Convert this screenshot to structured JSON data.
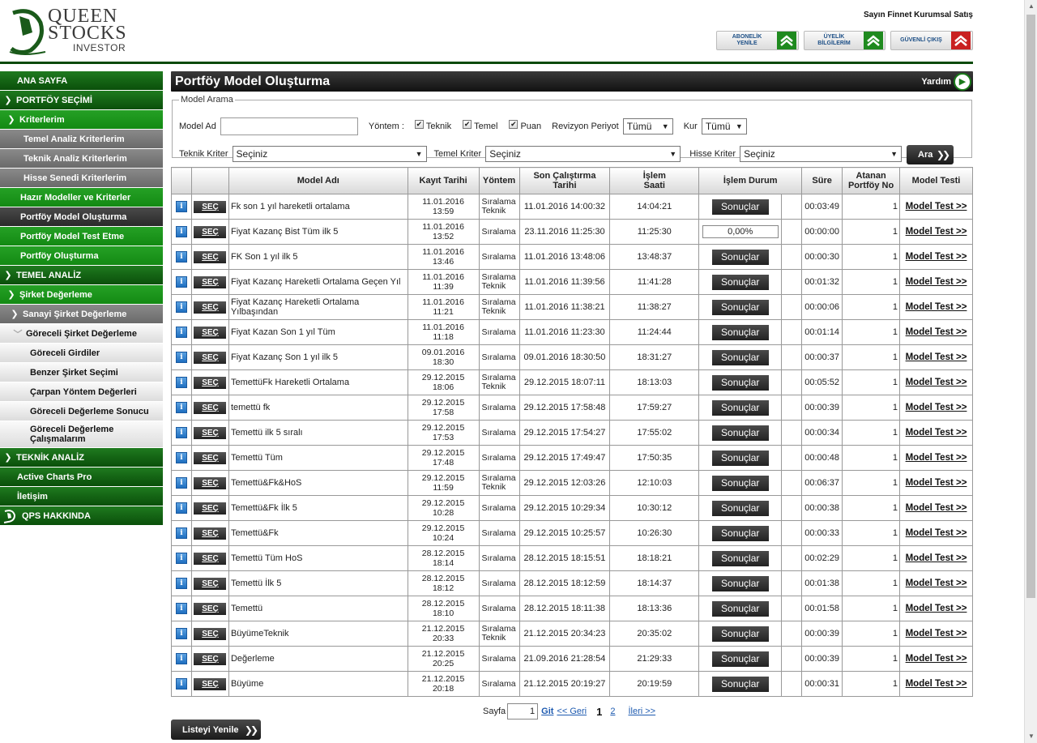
{
  "brand": {
    "line1": "QUEEN",
    "line2": "STOCKS",
    "line3": "INVESTOR"
  },
  "header": {
    "user": "Sayın Finnet Kurumsal Satış",
    "buttons": [
      {
        "label1": "ABONELİK",
        "label2": "YENİLE",
        "icon": "green-chevron-up-icon"
      },
      {
        "label1": "ÜYELİK",
        "label2": "BİLGİLERİM",
        "icon": "green-chevron-up-icon"
      },
      {
        "label1": "GÜVENLİ ÇIKIŞ",
        "label2": "",
        "icon": "red-chevron-up-icon"
      }
    ]
  },
  "sidebar": {
    "items": [
      {
        "label": "ANA SAYFA"
      },
      {
        "label": "PORTFÖY SEÇİMİ"
      },
      {
        "label": "Kriterlerim"
      },
      {
        "label": "Temel Analiz Kriterlerim"
      },
      {
        "label": "Teknik Analiz Kriterlerim"
      },
      {
        "label": "Hisse Senedi Kriterlerim"
      },
      {
        "label": "Hazır Modeller ve Kriterler"
      },
      {
        "label": "Portföy Model Oluşturma"
      },
      {
        "label": "Portföy Model Test Etme"
      },
      {
        "label": "Portföy Oluşturma"
      },
      {
        "label": "TEMEL ANALİZ"
      },
      {
        "label": "Şirket Değerleme"
      },
      {
        "label": "Sanayi Şirket Değerleme"
      },
      {
        "label": "Göreceli Şirket Değerleme"
      },
      {
        "label": "Göreceli Girdiler"
      },
      {
        "label": "Benzer Şirket Seçimi"
      },
      {
        "label": "Çarpan Yöntem Değerleri"
      },
      {
        "label": "Göreceli Değerleme Sonucu"
      },
      {
        "label": "Göreceli Değerleme Çalışmalarım"
      },
      {
        "label": "TEKNİK ANALİZ"
      },
      {
        "label": "Active Charts Pro"
      },
      {
        "label": "İletişim"
      },
      {
        "label": "QPS HAKKINDA"
      }
    ]
  },
  "page": {
    "title": "Portföy Model Oluşturma",
    "help": "Yardım"
  },
  "search": {
    "legend": "Model Arama",
    "model_ad_label": "Model Ad",
    "model_ad_value": "",
    "yontem_label": "Yöntem :",
    "teknik": "Teknik",
    "temel": "Temel",
    "puan": "Puan",
    "revizyon_label": "Revizyon Periyot",
    "revizyon_value": "Tümü",
    "kur_label": "Kur",
    "kur_value": "Tümü",
    "teknik_kriter_label": "Teknik Kriter",
    "teknik_kriter_value": "Seçiniz",
    "temel_kriter_label": "Temel Kriter",
    "temel_kriter_value": "Seçiniz",
    "hisse_kriter_label": "Hisse Kriter",
    "hisse_kriter_value": "Seçiniz",
    "search_button": "Ara"
  },
  "table": {
    "headers": {
      "model_adi": "Model Adı",
      "kayit": "Kayıt Tarihi",
      "yontem": "Yöntem",
      "son1": "Son Çalıştırma",
      "son2": "Tarihi",
      "islem1": "İşlem",
      "islem2": "Saati",
      "durum": "İşlem Durum",
      "sure": "Süre",
      "atanan1": "Atanan",
      "atanan2": "Portföy No",
      "test": "Model Testi"
    },
    "select_label": "SEÇ",
    "results_label": "Sonuçlar",
    "test_label": "Model Test >>",
    "rows": [
      {
        "name": "Fk son 1 yıl hareketli ortalama",
        "kd": "11.01.2016",
        "kt": "13:59",
        "y1": "Sıralama",
        "y2": "Teknik",
        "son": "11.01.2016 14:00:32",
        "saat": "14:04:21",
        "progress": "",
        "sure": "00:03:49",
        "no": "1"
      },
      {
        "name": "Fiyat Kazanç Bist Tüm ilk 5",
        "kd": "11.01.2016",
        "kt": "13:52",
        "y1": "Sıralama",
        "y2": "",
        "son": "23.11.2016 11:25:30",
        "saat": "11:25:30",
        "progress": "0,00%",
        "sure": "00:00:00",
        "no": "1"
      },
      {
        "name": "FK Son 1 yıl ilk 5",
        "kd": "11.01.2016",
        "kt": "13:46",
        "y1": "Sıralama",
        "y2": "",
        "son": "11.01.2016 13:48:06",
        "saat": "13:48:37",
        "progress": "",
        "sure": "00:00:30",
        "no": "1"
      },
      {
        "name": "Fiyat Kazanç Hareketli Ortalama Geçen Yıl",
        "kd": "11.01.2016",
        "kt": "11:39",
        "y1": "Sıralama",
        "y2": "Teknik",
        "son": "11.01.2016 11:39:56",
        "saat": "11:41:28",
        "progress": "",
        "sure": "00:01:32",
        "no": "1"
      },
      {
        "name": "Fiyat Kazanç Hareketli Ortalama Yılbaşından",
        "kd": "11.01.2016",
        "kt": "11:21",
        "y1": "Sıralama",
        "y2": "Teknik",
        "son": "11.01.2016 11:38:21",
        "saat": "11:38:27",
        "progress": "",
        "sure": "00:00:06",
        "no": "1"
      },
      {
        "name": "Fiyat Kazan Son 1 yıl Tüm",
        "kd": "11.01.2016",
        "kt": "11:18",
        "y1": "Sıralama",
        "y2": "",
        "son": "11.01.2016 11:23:30",
        "saat": "11:24:44",
        "progress": "",
        "sure": "00:01:14",
        "no": "1"
      },
      {
        "name": "Fiyat Kazanç Son 1 yıl ilk 5",
        "kd": "09.01.2016",
        "kt": "18:30",
        "y1": "Sıralama",
        "y2": "",
        "son": "09.01.2016 18:30:50",
        "saat": "18:31:27",
        "progress": "",
        "sure": "00:00:37",
        "no": "1"
      },
      {
        "name": "TemettüFk Hareketli Ortalama",
        "kd": "29.12.2015",
        "kt": "18:06",
        "y1": "Sıralama",
        "y2": "Teknik",
        "son": "29.12.2015 18:07:11",
        "saat": "18:13:03",
        "progress": "",
        "sure": "00:05:52",
        "no": "1"
      },
      {
        "name": "temettü fk",
        "kd": "29.12.2015",
        "kt": "17:58",
        "y1": "Sıralama",
        "y2": "",
        "son": "29.12.2015 17:58:48",
        "saat": "17:59:27",
        "progress": "",
        "sure": "00:00:39",
        "no": "1"
      },
      {
        "name": "Temettü ilk 5 sıralı",
        "kd": "29.12.2015",
        "kt": "17:53",
        "y1": "Sıralama",
        "y2": "",
        "son": "29.12.2015 17:54:27",
        "saat": "17:55:02",
        "progress": "",
        "sure": "00:00:34",
        "no": "1"
      },
      {
        "name": "Temettü Tüm",
        "kd": "29.12.2015",
        "kt": "17:48",
        "y1": "Sıralama",
        "y2": "",
        "son": "29.12.2015 17:49:47",
        "saat": "17:50:35",
        "progress": "",
        "sure": "00:00:48",
        "no": "1"
      },
      {
        "name": "Temettü&Fk&HoS",
        "kd": "29.12.2015",
        "kt": "11:59",
        "y1": "Sıralama",
        "y2": "Teknik",
        "son": "29.12.2015 12:03:26",
        "saat": "12:10:03",
        "progress": "",
        "sure": "00:06:37",
        "no": "1"
      },
      {
        "name": "Temettü&Fk İlk 5",
        "kd": "29.12.2015",
        "kt": "10:28",
        "y1": "Sıralama",
        "y2": "",
        "son": "29.12.2015 10:29:34",
        "saat": "10:30:12",
        "progress": "",
        "sure": "00:00:38",
        "no": "1"
      },
      {
        "name": "Temettü&Fk",
        "kd": "29.12.2015",
        "kt": "10:24",
        "y1": "Sıralama",
        "y2": "",
        "son": "29.12.2015 10:25:57",
        "saat": "10:26:30",
        "progress": "",
        "sure": "00:00:33",
        "no": "1"
      },
      {
        "name": "Temettü Tüm HoS",
        "kd": "28.12.2015",
        "kt": "18:14",
        "y1": "Sıralama",
        "y2": "",
        "son": "28.12.2015 18:15:51",
        "saat": "18:18:21",
        "progress": "",
        "sure": "00:02:29",
        "no": "1"
      },
      {
        "name": "Temettü İlk 5",
        "kd": "28.12.2015",
        "kt": "18:12",
        "y1": "Sıralama",
        "y2": "",
        "son": "28.12.2015 18:12:59",
        "saat": "18:14:37",
        "progress": "",
        "sure": "00:01:38",
        "no": "1"
      },
      {
        "name": "Temettü",
        "kd": "28.12.2015",
        "kt": "18:10",
        "y1": "Sıralama",
        "y2": "",
        "son": "28.12.2015 18:11:38",
        "saat": "18:13:36",
        "progress": "",
        "sure": "00:01:58",
        "no": "1"
      },
      {
        "name": "BüyümeTeknik",
        "kd": "21.12.2015",
        "kt": "20:33",
        "y1": "Sıralama",
        "y2": "Teknik",
        "son": "21.12.2015 20:34:23",
        "saat": "20:35:02",
        "progress": "",
        "sure": "00:00:39",
        "no": "1"
      },
      {
        "name": "Değerleme",
        "kd": "21.12.2015",
        "kt": "20:25",
        "y1": "Sıralama",
        "y2": "",
        "son": "21.09.2016 21:28:54",
        "saat": "21:29:33",
        "progress": "",
        "sure": "00:00:39",
        "no": "1"
      },
      {
        "name": "Büyüme",
        "kd": "21.12.2015",
        "kt": "20:18",
        "y1": "Sıralama",
        "y2": "",
        "son": "21.12.2015 20:19:27",
        "saat": "20:19:59",
        "progress": "",
        "sure": "00:00:31",
        "no": "1"
      }
    ]
  },
  "pager": {
    "label": "Sayfa",
    "value": "1",
    "go": "Git",
    "prev": "<< Geri",
    "current": "1",
    "next_page": "2",
    "next": "İleri >>"
  },
  "refresh_button": "Listeyi Yenile",
  "colors": {
    "accent": "#138a13",
    "dark": "#222222",
    "link": "#1d5ab0"
  }
}
